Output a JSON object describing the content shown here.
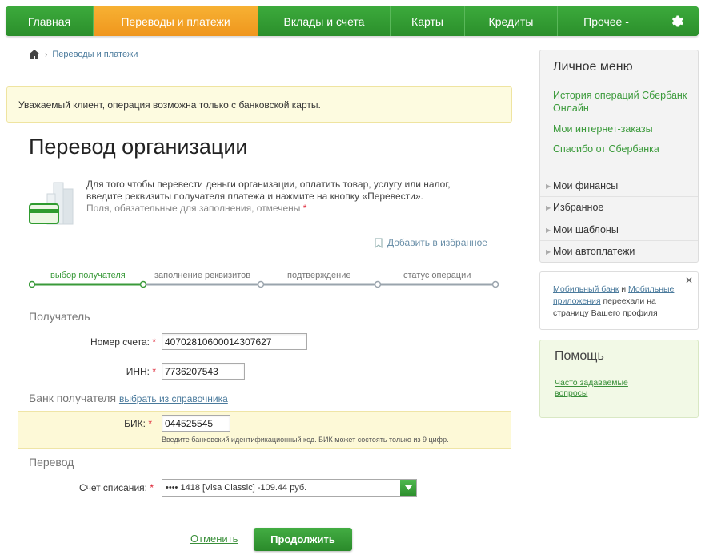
{
  "nav": {
    "items": [
      {
        "label": "Главная"
      },
      {
        "label": "Переводы и платежи"
      },
      {
        "label": "Вклады и счета"
      },
      {
        "label": "Карты"
      },
      {
        "label": "Кредиты"
      },
      {
        "label": "Прочее -"
      }
    ],
    "active_index": 1
  },
  "breadcrumb": {
    "current": "Переводы и платежи"
  },
  "notice": "Уважаемый клиент, операция возможна только с банковской карты.",
  "page_title": "Перевод организации",
  "intro": {
    "text": "Для того чтобы перевести деньги организации, оплатить товар, услугу или налог, введите реквизиты получателя платежа и нажмите на кнопку «Перевести».",
    "hint": "Поля, обязательные для заполнения, отмечены",
    "req_mark": "*"
  },
  "favorites_link": "Добавить в избранное",
  "steps": [
    {
      "label": "выбор получателя",
      "active": true
    },
    {
      "label": "заполнение реквизитов",
      "active": false
    },
    {
      "label": "подтверждение",
      "active": false
    },
    {
      "label": "статус операции",
      "active": false
    }
  ],
  "form": {
    "recipient_title": "Получатель",
    "account_label": "Номер счета:",
    "account_value": "40702810600014307627",
    "inn_label": "ИНН:",
    "inn_value": "7736207543",
    "bank_title": "Банк получателя",
    "bank_directory_link": "выбрать из справочника",
    "bik_label": "БИК:",
    "bik_value": "044525545",
    "bik_hint": "Введите банковский идентификационный код. БИК может состоять только из 9 цифр.",
    "transfer_title": "Перевод",
    "debit_label": "Счет списания:",
    "debit_value": "•••• 1418 [Visa Classic] -109.44 руб.",
    "req_mark": "*"
  },
  "actions": {
    "cancel": "Отменить",
    "continue": "Продолжить"
  },
  "personal_menu": {
    "title": "Личное меню",
    "links": [
      "История операций Сбербанк Онлайн",
      "Мои интернет-заказы",
      "Спасибо от Сбербанка"
    ],
    "sections": [
      "Мои финансы",
      "Избранное",
      "Мои шаблоны",
      "Мои автоплатежи"
    ]
  },
  "notification": {
    "link1": "Мобильный банк",
    "and": " и ",
    "link2": "Мобильные приложения",
    "rest": " переехали на страницу Вашего профиля",
    "close": "✕"
  },
  "help": {
    "title": "Помощь",
    "faq": "Часто задаваемые вопросы"
  },
  "colors": {
    "brand_green": "#2f9b2f",
    "active_orange": "#f2a126",
    "notice_bg": "#fdfbe0"
  },
  "icons": {
    "home": "home-icon",
    "settings": "gear-icon",
    "favorites": "bookmark-icon",
    "dropdown": "chevron-down-icon"
  }
}
